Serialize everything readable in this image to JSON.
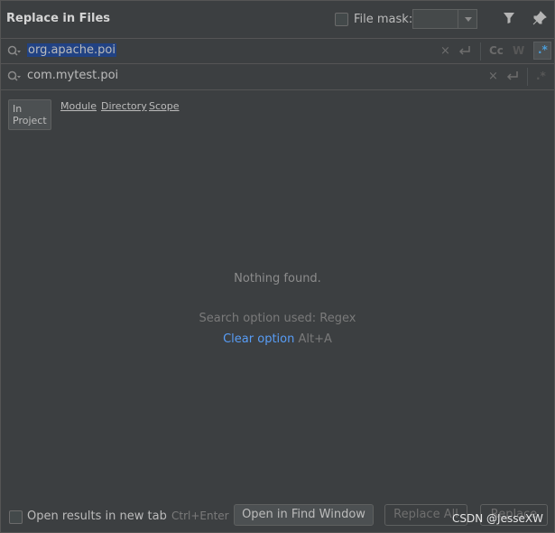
{
  "window": {
    "title": "Replace in Files"
  },
  "file_mask": {
    "label": "File mask:",
    "value": ""
  },
  "search": {
    "query": "org.apache.poi",
    "clear": "×",
    "match_case": "Cc",
    "words": "W",
    "regex": ".*"
  },
  "replace": {
    "value": "com.mytest.poi",
    "clear": "×",
    "regex": ".*"
  },
  "scope": {
    "tabs": [
      "In Project",
      "Module",
      "Directory",
      "Scope"
    ],
    "selected": "In Project"
  },
  "results": {
    "empty_message": "Nothing found.",
    "search_option": "Search option used: Regex",
    "clear_option_link": "Clear option",
    "clear_option_shortcut": "Alt+A"
  },
  "footer": {
    "open_new_tab_label": "Open results in new tab",
    "shortcut_hint": "Ctrl+Enter",
    "open_find_window": "Open in Find Window",
    "replace_all": "Replace All",
    "replace": "Replace"
  },
  "watermark": "CSDN @JesseXW",
  "colors": {
    "selection": "#214283",
    "link": "#589df6",
    "background": "#3c3f41"
  }
}
